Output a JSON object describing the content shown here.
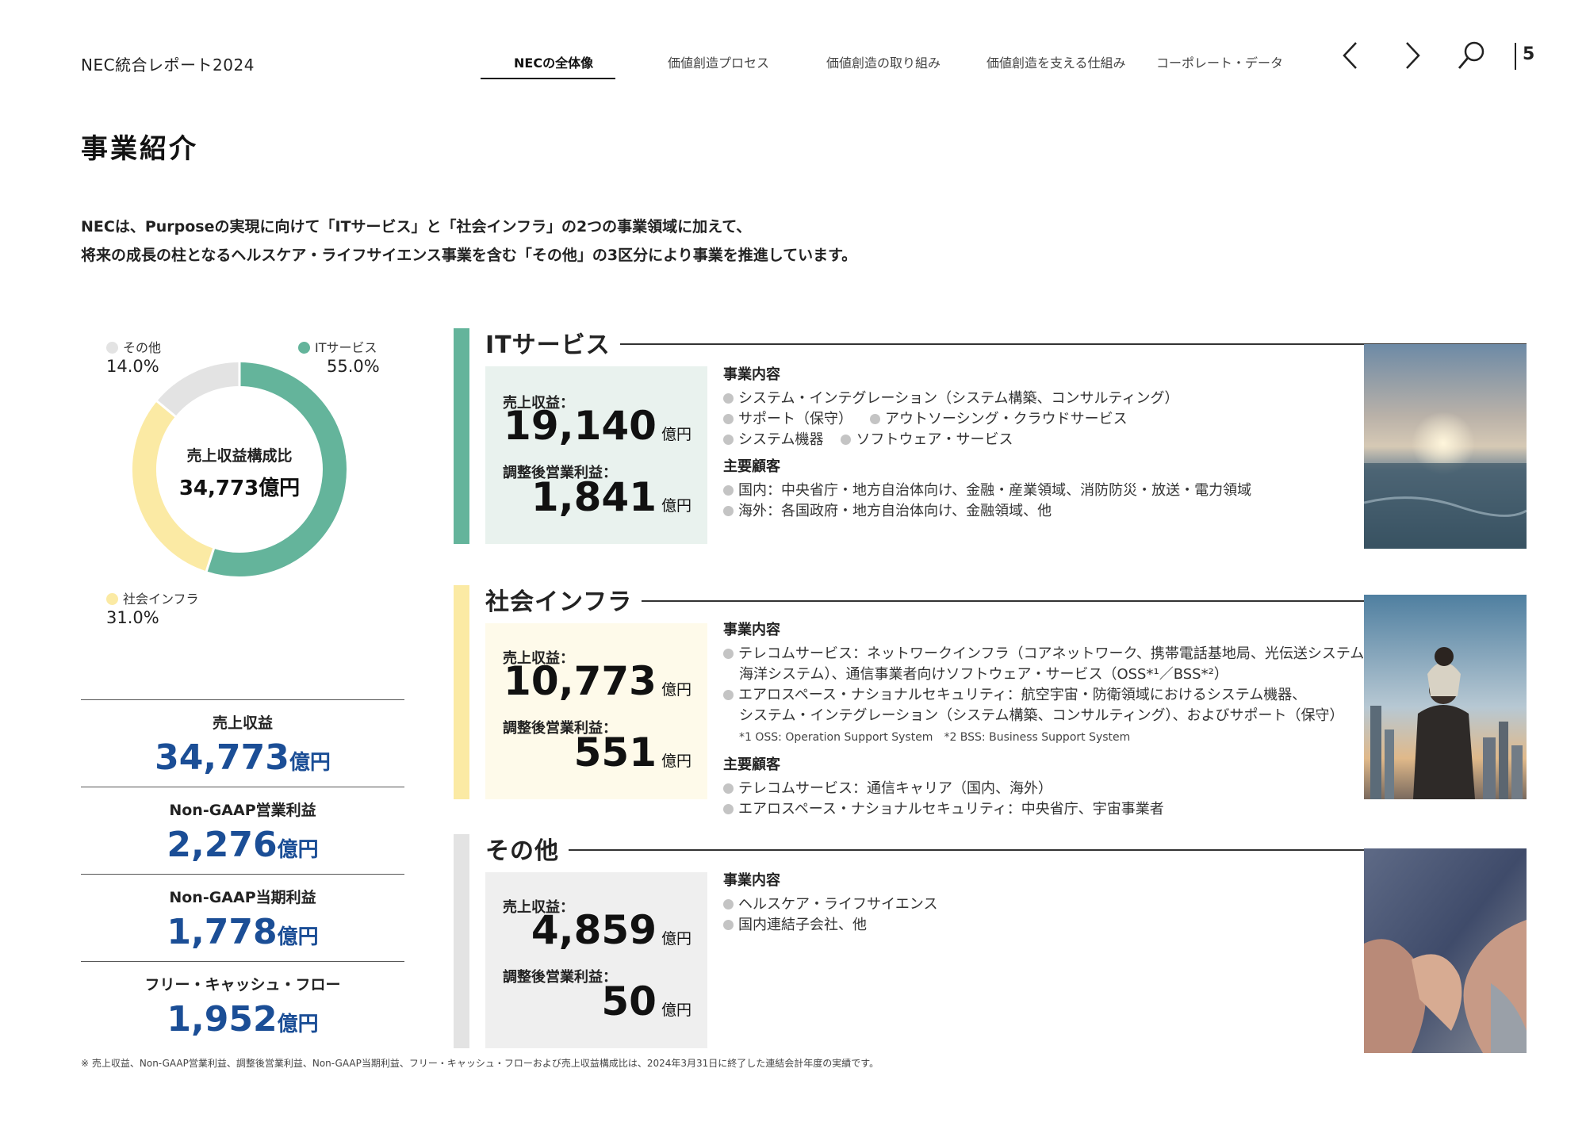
{
  "header": {
    "brand": "NEC統合レポート2024",
    "tabs": [
      {
        "label": "NECの全体像",
        "active": true
      },
      {
        "label": "価値創造プロセス"
      },
      {
        "label": "価値創造の取り組み"
      },
      {
        "label": "価値創造を支える仕組み"
      },
      {
        "label": "コーポレート・データ"
      }
    ],
    "icons": [
      "chevron-left-icon",
      "chevron-right-icon",
      "search-icon"
    ],
    "page_number": "5"
  },
  "page_title": "事業紹介",
  "intro": {
    "line1": "NECは、Purposeの実現に向けて「ITサービス」と「社会インフラ」の2つの事業領域に加えて、",
    "line2": "将来の成長の柱となるヘルスケア・ライフサイエンス事業を含む「その他」の3区分により事業を推進しています。"
  },
  "donut": {
    "center_label": "売上収益構成比",
    "center_value": "34,773億円",
    "segments": [
      {
        "name": "ITサービス",
        "percent_label": "55.0%",
        "value": 55.0,
        "color": "#64b49b"
      },
      {
        "name": "社会インフラ",
        "percent_label": "31.0%",
        "value": 31.0,
        "color": "#fbeaa4"
      },
      {
        "name": "その他",
        "percent_label": "14.0%",
        "value": 14.0,
        "color": "#e3e3e3"
      }
    ]
  },
  "kpis": [
    {
      "label": "売上収益",
      "value": "34,773",
      "unit": "億円"
    },
    {
      "label": "Non-GAAP営業利益",
      "value": "2,276",
      "unit": "億円"
    },
    {
      "label": "Non-GAAP当期利益",
      "value": "1,778",
      "unit": "億円"
    },
    {
      "label": "フリー・キャッシュ・フロー",
      "value": "1,952",
      "unit": "億円"
    }
  ],
  "footnote": "※ 売上収益、Non-GAAP営業利益、調整後営業利益、Non-GAAP当期利益、フリー・キャッシュ・フローおよび売上収益構成比は、2024年3月31日に終了した連結会計年度の実績です。",
  "segments": {
    "it": {
      "title": "ITサービス",
      "color": "#64b49b",
      "box_bg": "#e9f2ee",
      "revenue_label": "売上収益：",
      "revenue_value": "19,140",
      "profit_label": "調整後営業利益：",
      "profit_value": "1,841",
      "unit": "億円",
      "business_heading": "事業内容",
      "business_items": {
        "i1": "システム・インテグレーション（システム構築、コンサルティング）",
        "i2": "サポート（保守）",
        "i3": "アウトソーシング・クラウドサービス",
        "i4": "システム機器",
        "i5": "ソフトウェア・サービス"
      },
      "customer_heading": "主要顧客",
      "customer_items": {
        "c1": "国内：中央省庁・地方自治体向け、金融・産業領域、消防防災・放送・電力領域",
        "c2": "海外：各国政府・地方自治体向け、金融領域、他"
      }
    },
    "infra": {
      "title": "社会インフラ",
      "color": "#fbeaa4",
      "box_bg": "#fefaea",
      "revenue_label": "売上収益：",
      "revenue_value": "10,773",
      "profit_label": "調整後営業利益：",
      "profit_value": "551",
      "unit": "億円",
      "business_heading": "事業内容",
      "business_items": {
        "i1a": "テレコムサービス：ネットワークインフラ（コアネットワーク、携帯電話基地局、光伝送システム、",
        "i1b": "海洋システム）、通信事業者向けソフトウェア・サービス（OSS*¹／BSS*²）",
        "i2a": "エアロスペース・ナショナルセキュリティ：航空宇宙・防衛領域におけるシステム機器、",
        "i2b": "システム・インテグレーション（システム構築、コンサルティング）、およびサポート（保守）",
        "note": "*1 OSS: Operation Support System　*2 BSS: Business Support System"
      },
      "customer_heading": "主要顧客",
      "customer_items": {
        "c1": "テレコムサービス：通信キャリア（国内、海外）",
        "c2": "エアロスペース・ナショナルセキュリティ：中央省庁、宇宙事業者"
      }
    },
    "other": {
      "title": "その他",
      "color": "#e3e3e3",
      "box_bg": "#efefef",
      "revenue_label": "売上収益：",
      "revenue_value": "4,859",
      "profit_label": "調整後営業利益：",
      "profit_value": "50",
      "unit": "億円",
      "business_heading": "事業内容",
      "business_items": {
        "i1": "ヘルスケア・ライフサイエンス",
        "i2": "国内連結子会社、他"
      }
    }
  }
}
